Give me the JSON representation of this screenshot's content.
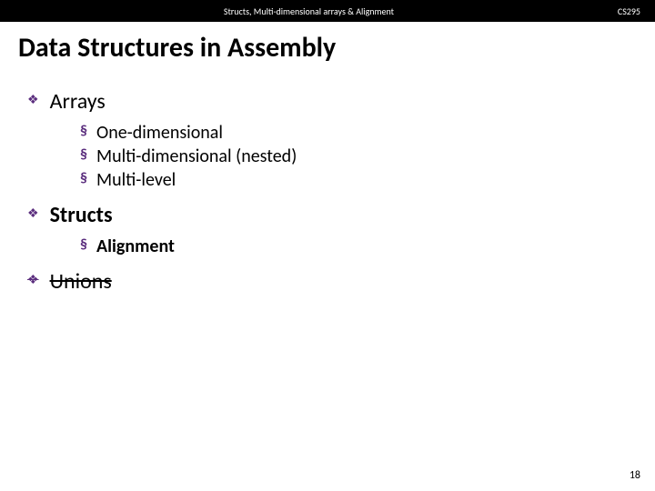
{
  "header": {
    "center": "Structs, Multi-dimensional arrays & Alignment",
    "right": "CS295"
  },
  "title": "Data Structures in Assembly",
  "items": [
    {
      "label": "Arrays",
      "bold": false,
      "strike": false,
      "sub": [
        {
          "label": "One-dimensional",
          "bold": false
        },
        {
          "label": "Multi-dimensional (nested)",
          "bold": false
        },
        {
          "label": "Multi-level",
          "bold": false
        }
      ]
    },
    {
      "label": "Structs",
      "bold": true,
      "strike": false,
      "sub": [
        {
          "label": "Alignment",
          "bold": true
        }
      ]
    },
    {
      "label": "Unions",
      "bold": false,
      "strike": true,
      "sub": []
    }
  ],
  "pageNumber": "18"
}
